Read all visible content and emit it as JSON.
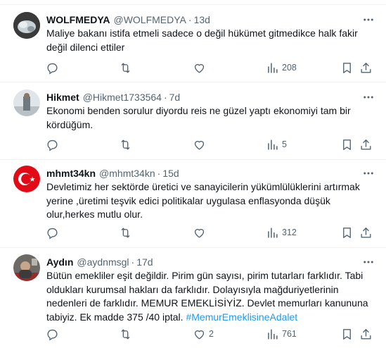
{
  "icons": {
    "more": "more-horizontal-icon",
    "reply": "reply-icon",
    "retweet": "retweet-icon",
    "like": "like-icon",
    "views": "views-icon",
    "bookmark": "bookmark-icon",
    "share": "share-icon"
  },
  "colors": {
    "text": "#0f1419",
    "muted": "#536471",
    "link": "#1d9bf0",
    "divider": "#eff3f4"
  },
  "tweets": [
    {
      "name": "WOLFMEDYA",
      "handle": "@WOLFMEDYA",
      "dot": "·",
      "time": "13d",
      "lines": [
        "Maliye bakanı istifa etmeli sadece o değil hükümet gitmedikce halk fakir",
        "değil dilenci ettiler"
      ],
      "views": "208",
      "replies": "",
      "retweets": "",
      "likes": ""
    },
    {
      "name": "Hikmet",
      "handle": "@Hikmet1733564",
      "dot": "·",
      "time": "7d",
      "lines": [
        "Ekonomi benden sorulur diyordu reis ne güzel yaptı ekonomiyi tam bir",
        "kördüğüm."
      ],
      "views": "5",
      "replies": "",
      "retweets": "",
      "likes": ""
    },
    {
      "name": "mhmt34kn",
      "handle": "@mhmt34kn",
      "dot": "·",
      "time": "15d",
      "lines": [
        "Devletimiz her sektörde  üretici ve sanayicilerin yükümlülüklerini artırmak",
        "yerine ,üretimi teşvik edici politikalar uygulasa enflasyonda düşük",
        "olur,herkes mutlu olur."
      ],
      "views": "312",
      "replies": "",
      "retweets": "",
      "likes": ""
    },
    {
      "name": "Aydın",
      "handle": "@aydnmsgl",
      "dot": "·",
      "time": "17d",
      "lines": [
        "Bütün emekliler eşit değildir. Pirim gün sayısı, pirim tutarları farklıdır. Tabi",
        "oldukları kurumsal hakları da farklıdır. Dolayısıyla mağduriyetlerinin",
        "nedenleri de farklıdır. MEMUR EMEKLİSİYİZ. Devlet memurları kanununa"
      ],
      "last_line_text": "tabiyiz. Ek madde 375 /40 iptal. ",
      "hashtag": "#MemurEmeklisineAdalet",
      "views": "761",
      "replies": "",
      "retweets": "",
      "likes": "2"
    }
  ]
}
